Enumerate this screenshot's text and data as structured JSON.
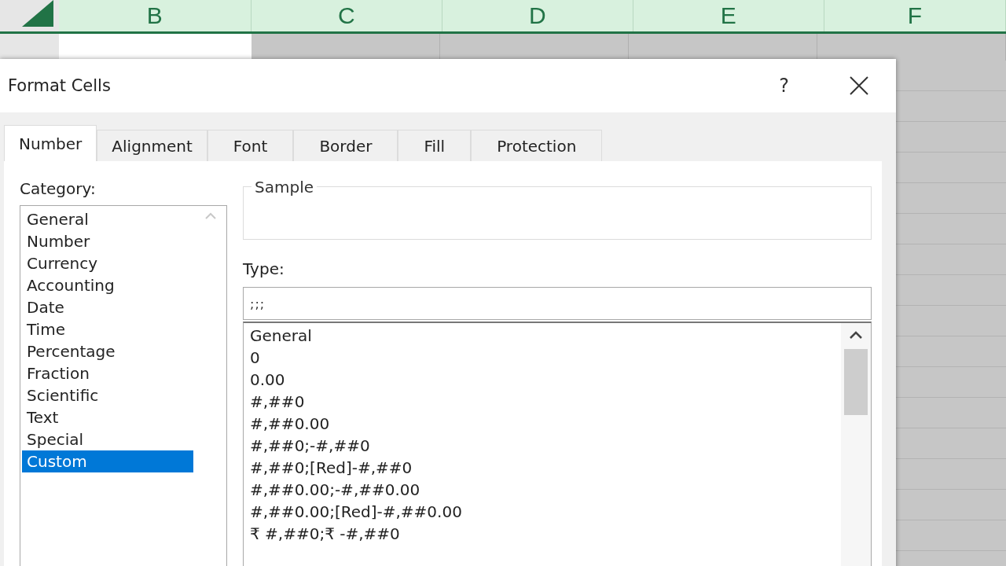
{
  "sheet": {
    "columns": [
      "B",
      "C",
      "D",
      "E",
      "F"
    ]
  },
  "window": {
    "title": "Format Cells",
    "help": "?"
  },
  "tabs": [
    {
      "label": "Number",
      "selected": true
    },
    {
      "label": "Alignment",
      "selected": false
    },
    {
      "label": "Font",
      "selected": false
    },
    {
      "label": "Border",
      "selected": false
    },
    {
      "label": "Fill",
      "selected": false
    },
    {
      "label": "Protection",
      "selected": false
    }
  ],
  "category": {
    "label": "Category:",
    "items": [
      {
        "label": "General",
        "selected": false
      },
      {
        "label": "Number",
        "selected": false
      },
      {
        "label": "Currency",
        "selected": false
      },
      {
        "label": "Accounting",
        "selected": false
      },
      {
        "label": "Date",
        "selected": false
      },
      {
        "label": "Time",
        "selected": false
      },
      {
        "label": "Percentage",
        "selected": false
      },
      {
        "label": "Fraction",
        "selected": false
      },
      {
        "label": "Scientific",
        "selected": false
      },
      {
        "label": "Text",
        "selected": false
      },
      {
        "label": "Special",
        "selected": false
      },
      {
        "label": "Custom",
        "selected": true
      }
    ]
  },
  "sample": {
    "label": "Sample"
  },
  "type": {
    "label": "Type:",
    "value": ";;;",
    "items": [
      "General",
      "0",
      "0.00",
      "#,##0",
      "#,##0.00",
      "#,##0;-#,##0",
      "#,##0;[Red]-#,##0",
      "#,##0.00;-#,##0.00",
      "#,##0.00;[Red]-#,##0.00",
      "₹ #,##0;₹ -#,##0"
    ]
  }
}
